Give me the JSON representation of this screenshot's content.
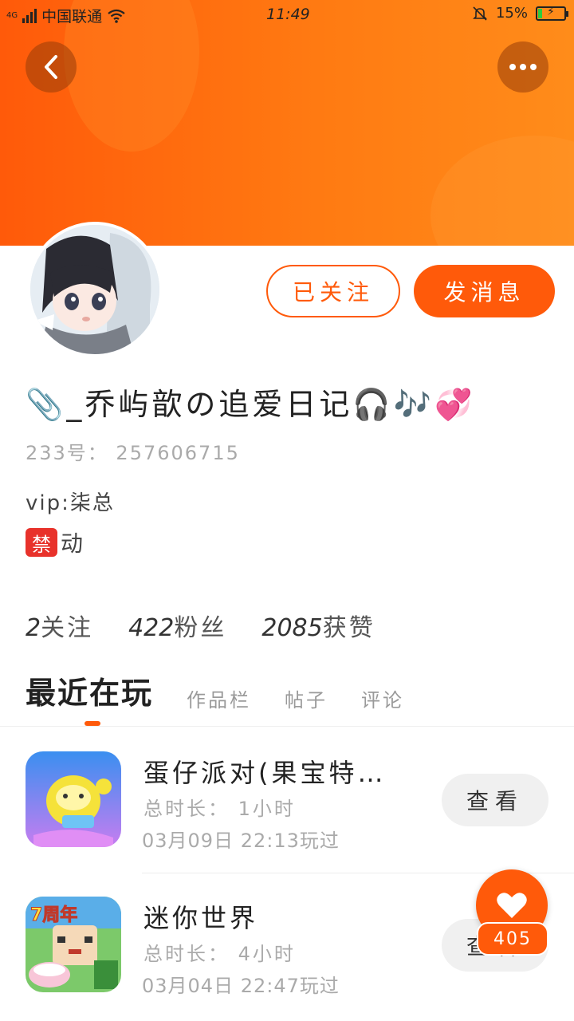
{
  "status_bar": {
    "network": "4G",
    "carrier": "中国联通",
    "time": "11:49",
    "battery": "15%",
    "battery_level": 0.15
  },
  "header": {
    "back_icon": "chevron-left-icon",
    "more_icon": "more-dots-icon"
  },
  "profile": {
    "follow_label": "已关注",
    "message_label": "发消息",
    "nickname": "📎_乔屿歆の追爱日记🎧🎶💞",
    "account_id": "233号： 257606715",
    "bio_line1": "vip:柒总",
    "ban_badge": "禁",
    "bio_line2_text": "动"
  },
  "stats": [
    {
      "num": "2",
      "label": "关注"
    },
    {
      "num": "422",
      "label": "粉丝"
    },
    {
      "num": "2085",
      "label": "获赞"
    }
  ],
  "tabs": [
    {
      "label": "最近在玩",
      "active": true
    },
    {
      "label": "作品栏",
      "active": false
    },
    {
      "label": "帖子",
      "active": false
    },
    {
      "label": "评论",
      "active": false
    }
  ],
  "games": [
    {
      "title": "蛋仔派对(果宝特…",
      "duration": "总时长： 1小时",
      "date": "03月09日 22:13玩过",
      "button": "查看"
    },
    {
      "title": "迷你世界",
      "duration": "总时长： 4小时",
      "date": "03月04日 22:47玩过",
      "button": "查看"
    }
  ],
  "like": {
    "count": "405",
    "icon": "heart-icon"
  },
  "colors": {
    "accent": "#ff5a0a",
    "header_gradient_end": "#ff8c1a"
  }
}
